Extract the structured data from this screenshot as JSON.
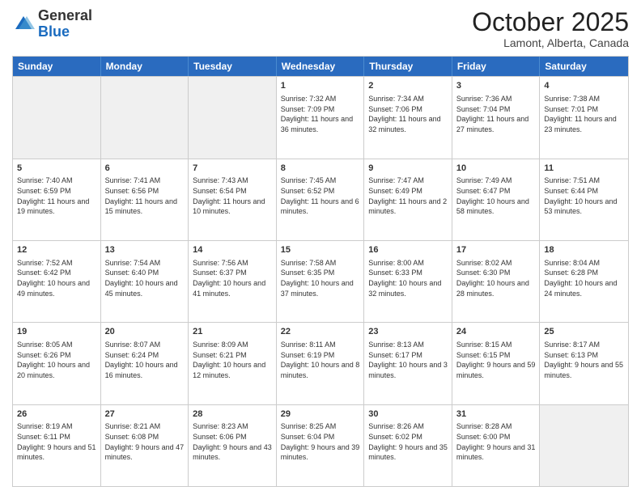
{
  "header": {
    "logo_general": "General",
    "logo_blue": "Blue",
    "month": "October 2025",
    "location": "Lamont, Alberta, Canada"
  },
  "weekdays": [
    "Sunday",
    "Monday",
    "Tuesday",
    "Wednesday",
    "Thursday",
    "Friday",
    "Saturday"
  ],
  "rows": [
    [
      {
        "day": "",
        "info": "",
        "shaded": true
      },
      {
        "day": "",
        "info": "",
        "shaded": true
      },
      {
        "day": "",
        "info": "",
        "shaded": true
      },
      {
        "day": "1",
        "info": "Sunrise: 7:32 AM\nSunset: 7:09 PM\nDaylight: 11 hours and 36 minutes."
      },
      {
        "day": "2",
        "info": "Sunrise: 7:34 AM\nSunset: 7:06 PM\nDaylight: 11 hours and 32 minutes."
      },
      {
        "day": "3",
        "info": "Sunrise: 7:36 AM\nSunset: 7:04 PM\nDaylight: 11 hours and 27 minutes."
      },
      {
        "day": "4",
        "info": "Sunrise: 7:38 AM\nSunset: 7:01 PM\nDaylight: 11 hours and 23 minutes."
      }
    ],
    [
      {
        "day": "5",
        "info": "Sunrise: 7:40 AM\nSunset: 6:59 PM\nDaylight: 11 hours and 19 minutes."
      },
      {
        "day": "6",
        "info": "Sunrise: 7:41 AM\nSunset: 6:56 PM\nDaylight: 11 hours and 15 minutes."
      },
      {
        "day": "7",
        "info": "Sunrise: 7:43 AM\nSunset: 6:54 PM\nDaylight: 11 hours and 10 minutes."
      },
      {
        "day": "8",
        "info": "Sunrise: 7:45 AM\nSunset: 6:52 PM\nDaylight: 11 hours and 6 minutes."
      },
      {
        "day": "9",
        "info": "Sunrise: 7:47 AM\nSunset: 6:49 PM\nDaylight: 11 hours and 2 minutes."
      },
      {
        "day": "10",
        "info": "Sunrise: 7:49 AM\nSunset: 6:47 PM\nDaylight: 10 hours and 58 minutes."
      },
      {
        "day": "11",
        "info": "Sunrise: 7:51 AM\nSunset: 6:44 PM\nDaylight: 10 hours and 53 minutes."
      }
    ],
    [
      {
        "day": "12",
        "info": "Sunrise: 7:52 AM\nSunset: 6:42 PM\nDaylight: 10 hours and 49 minutes."
      },
      {
        "day": "13",
        "info": "Sunrise: 7:54 AM\nSunset: 6:40 PM\nDaylight: 10 hours and 45 minutes."
      },
      {
        "day": "14",
        "info": "Sunrise: 7:56 AM\nSunset: 6:37 PM\nDaylight: 10 hours and 41 minutes."
      },
      {
        "day": "15",
        "info": "Sunrise: 7:58 AM\nSunset: 6:35 PM\nDaylight: 10 hours and 37 minutes."
      },
      {
        "day": "16",
        "info": "Sunrise: 8:00 AM\nSunset: 6:33 PM\nDaylight: 10 hours and 32 minutes."
      },
      {
        "day": "17",
        "info": "Sunrise: 8:02 AM\nSunset: 6:30 PM\nDaylight: 10 hours and 28 minutes."
      },
      {
        "day": "18",
        "info": "Sunrise: 8:04 AM\nSunset: 6:28 PM\nDaylight: 10 hours and 24 minutes."
      }
    ],
    [
      {
        "day": "19",
        "info": "Sunrise: 8:05 AM\nSunset: 6:26 PM\nDaylight: 10 hours and 20 minutes."
      },
      {
        "day": "20",
        "info": "Sunrise: 8:07 AM\nSunset: 6:24 PM\nDaylight: 10 hours and 16 minutes."
      },
      {
        "day": "21",
        "info": "Sunrise: 8:09 AM\nSunset: 6:21 PM\nDaylight: 10 hours and 12 minutes."
      },
      {
        "day": "22",
        "info": "Sunrise: 8:11 AM\nSunset: 6:19 PM\nDaylight: 10 hours and 8 minutes."
      },
      {
        "day": "23",
        "info": "Sunrise: 8:13 AM\nSunset: 6:17 PM\nDaylight: 10 hours and 3 minutes."
      },
      {
        "day": "24",
        "info": "Sunrise: 8:15 AM\nSunset: 6:15 PM\nDaylight: 9 hours and 59 minutes."
      },
      {
        "day": "25",
        "info": "Sunrise: 8:17 AM\nSunset: 6:13 PM\nDaylight: 9 hours and 55 minutes."
      }
    ],
    [
      {
        "day": "26",
        "info": "Sunrise: 8:19 AM\nSunset: 6:11 PM\nDaylight: 9 hours and 51 minutes."
      },
      {
        "day": "27",
        "info": "Sunrise: 8:21 AM\nSunset: 6:08 PM\nDaylight: 9 hours and 47 minutes."
      },
      {
        "day": "28",
        "info": "Sunrise: 8:23 AM\nSunset: 6:06 PM\nDaylight: 9 hours and 43 minutes."
      },
      {
        "day": "29",
        "info": "Sunrise: 8:25 AM\nSunset: 6:04 PM\nDaylight: 9 hours and 39 minutes."
      },
      {
        "day": "30",
        "info": "Sunrise: 8:26 AM\nSunset: 6:02 PM\nDaylight: 9 hours and 35 minutes."
      },
      {
        "day": "31",
        "info": "Sunrise: 8:28 AM\nSunset: 6:00 PM\nDaylight: 9 hours and 31 minutes."
      },
      {
        "day": "",
        "info": "",
        "shaded": true
      }
    ]
  ]
}
